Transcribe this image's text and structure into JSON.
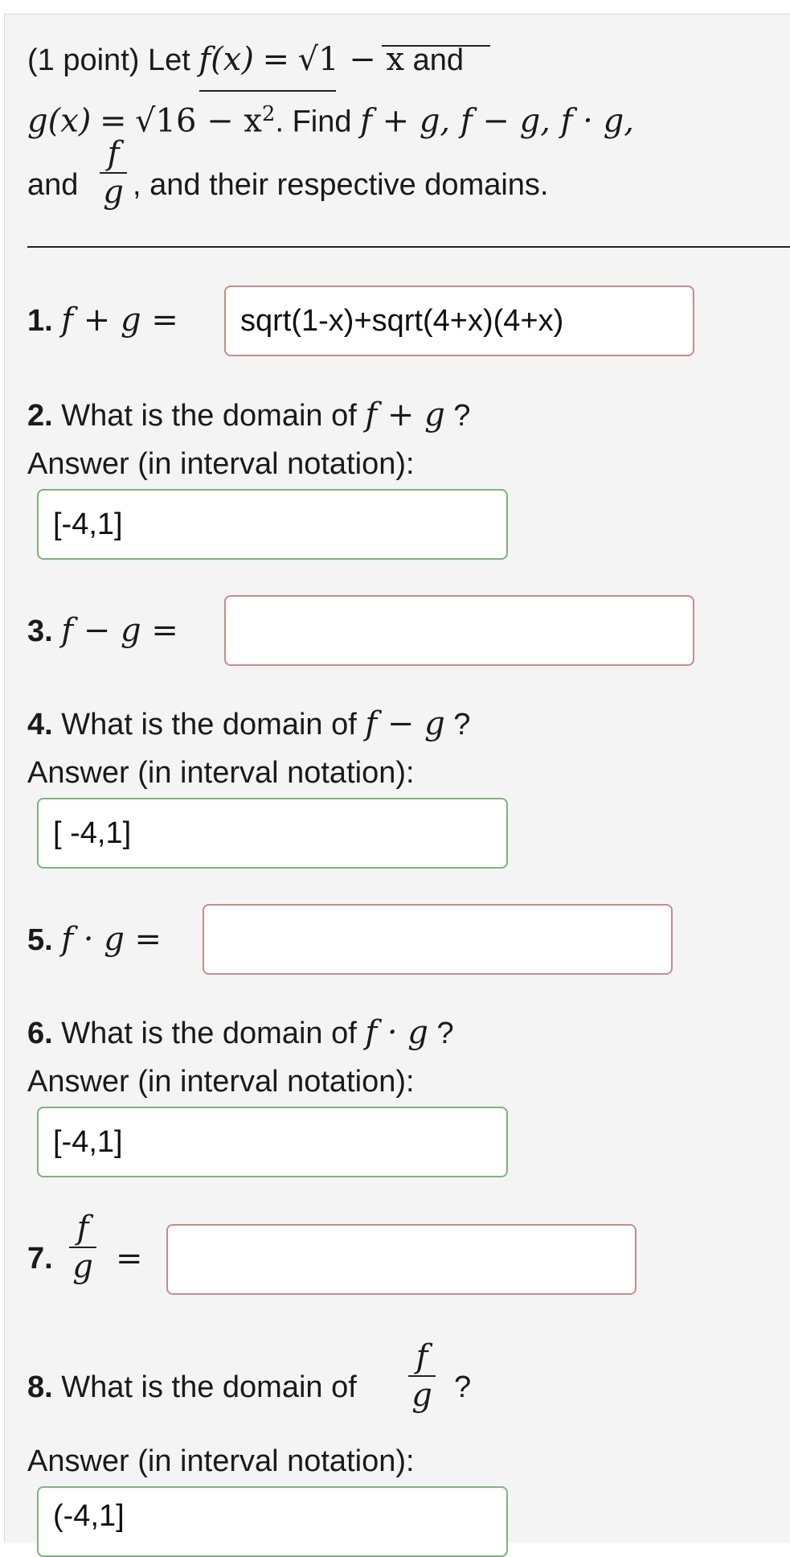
{
  "problem": {
    "intro_prefix": "(1 point) Let ",
    "f_lhs": "f(x)",
    "eq": "=",
    "sqrt_sign": "√",
    "f_rad": "1 − x",
    "and1": "and",
    "g_lhs": "g(x)",
    "g_rad": "16 − x",
    "g_exp": "2",
    "find_text": ". Find ",
    "ops": "f + g, f − g, f · g,",
    "and2": "and",
    "frac_num": "f",
    "frac_den": "g",
    "tail": ", and their respective domains."
  },
  "questions": {
    "q1": {
      "num": "1.",
      "expr": "f + g =",
      "value": "sqrt(1-x)+sqrt(4+x)(4+x)"
    },
    "q2": {
      "num": "2.",
      "text": " What is the domain of ",
      "expr": "f + g",
      "q": " ?",
      "sub": "Answer (in interval notation):",
      "value": "[-4,1]"
    },
    "q3": {
      "num": "3.",
      "expr": "f − g =",
      "value": ""
    },
    "q4": {
      "num": "4.",
      "text": " What is the domain of ",
      "expr": "f − g",
      "q": " ?",
      "sub": "Answer (in interval notation):",
      "value": "[ -4,1]"
    },
    "q5": {
      "num": "5.",
      "expr": "f · g =",
      "value": ""
    },
    "q6": {
      "num": "6.",
      "text": " What is the domain of ",
      "expr": "f · g",
      "q": " ?",
      "sub": "Answer (in interval notation):",
      "value": "[-4,1]"
    },
    "q7": {
      "num": "7.",
      "frac_num": "f",
      "frac_den": "g",
      "eq": "=",
      "value": ""
    },
    "q8": {
      "num": "8.",
      "text": " What is the domain of ",
      "frac_num": "f",
      "frac_den": "g",
      "q": "?",
      "sub": "Answer (in interval notation):",
      "value": "(-4,1]"
    }
  },
  "colors": {
    "incorrect_border": "#c98a8a",
    "correct_border": "#7bb57b",
    "panel_bg": "#f4f4f4"
  }
}
